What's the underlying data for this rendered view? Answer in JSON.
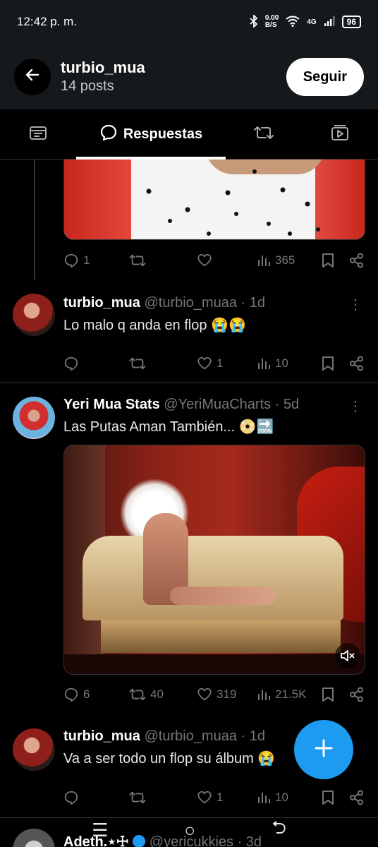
{
  "status_bar": {
    "time": "12:42 p. m.",
    "net_speed": "0.00",
    "net_unit": "B/S",
    "network": "4G",
    "battery": "96"
  },
  "header": {
    "title": "turbio_mua",
    "subtitle": "14 posts",
    "follow_label": "Seguir"
  },
  "tabs": {
    "active_label": "Respuestas"
  },
  "first_tweet_actions": {
    "replies": "1",
    "retweets": "",
    "likes": "",
    "views": "365"
  },
  "tweets": [
    {
      "name": "turbio_mua",
      "handle": "@turbio_muaa",
      "time": "· 1d",
      "text": "Lo malo q anda en flop",
      "emoji": "😭😭",
      "replies": "",
      "retweets": "",
      "likes": "1",
      "views": "10"
    },
    {
      "name": "Yeri Mua Stats",
      "handle": "@YeriMuaCharts",
      "time": "· 5d",
      "text": "Las Putas Aman También...",
      "emoji": "📀🔜",
      "replies": "6",
      "retweets": "40",
      "likes": "319",
      "views": "21.5K"
    },
    {
      "name": "turbio_mua",
      "handle": "@turbio_muaa",
      "time": "· 1d",
      "text": "Va a ser todo un flop su álbum",
      "emoji": "😭",
      "replies": "",
      "retweets": "",
      "likes": "1",
      "views": "10"
    },
    {
      "name": "Adeth.⋆☩",
      "handle": "@yericukkies",
      "time": "· 3d"
    }
  ],
  "colors": {
    "accent": "#1d9bf0",
    "background": "#000000",
    "muted": "#71767b"
  }
}
